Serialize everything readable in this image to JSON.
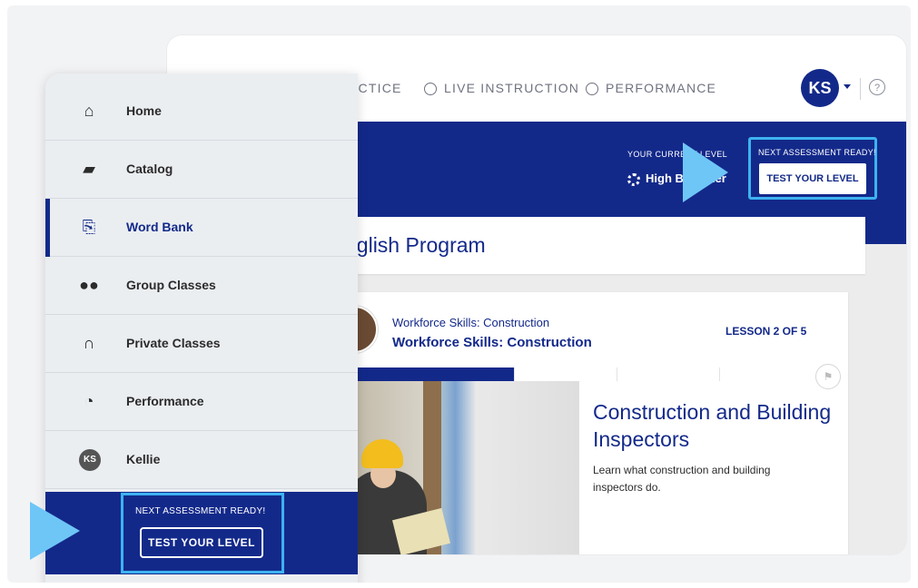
{
  "nav": {
    "items": [
      {
        "label": "PRACTICE",
        "icon": "practice-icon",
        "display": "ACTICE"
      },
      {
        "label": "LIVE INSTRUCTION",
        "icon": "headset-icon"
      },
      {
        "label": "PERFORMANCE",
        "icon": "performance-icon"
      }
    ],
    "avatar_initials": "KS",
    "help_symbol": "?"
  },
  "banner": {
    "current_level_label": "YOUR CURRENT LEVEL",
    "current_level_value": "High Beginner",
    "assessment_title": "NEXT ASSESSMENT READY!",
    "test_button": "TEST YOUR LEVEL"
  },
  "program": {
    "title": "nglish Program"
  },
  "lesson_card": {
    "course_subtitle": "Workforce Skills: Construction",
    "course_title": "Workforce Skills: Construction",
    "lesson_count": "LESSON 2 OF 5",
    "progress": {
      "completed": 1,
      "total": 5
    },
    "lesson_title": "Construction and Building Inspectors",
    "lesson_description": "Learn what construction and building inspectors do."
  },
  "sidebar": {
    "items": [
      {
        "label": "Home",
        "icon": "home-icon",
        "glyph": "⌂"
      },
      {
        "label": "Catalog",
        "icon": "book-icon",
        "glyph": "▰"
      },
      {
        "label": "Word Bank",
        "icon": "word-bank-icon",
        "glyph": "⎘",
        "active": true
      },
      {
        "label": "Group Classes",
        "icon": "group-icon",
        "glyph": "●●"
      },
      {
        "label": "Private Classes",
        "icon": "headset-icon",
        "glyph": "∩"
      },
      {
        "label": "Performance",
        "icon": "performance-icon",
        "glyph": "◔"
      },
      {
        "label": "Kellie",
        "icon": "avatar",
        "initials": "KS"
      }
    ],
    "assessment_title": "NEXT ASSESSMENT READY!",
    "test_button": "TEST YOUR LEVEL"
  },
  "colors": {
    "primary": "#13298a",
    "accent": "#3db2f0",
    "play": "#6ec6f7"
  }
}
